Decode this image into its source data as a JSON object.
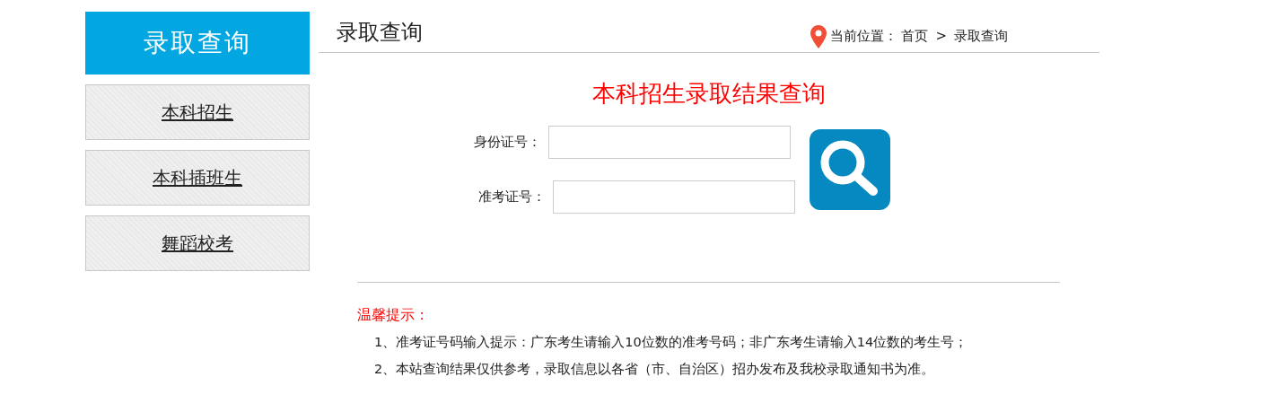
{
  "sidebar": {
    "title": "录取查询",
    "items": [
      {
        "label": "本科招生"
      },
      {
        "label": "本科插班生"
      },
      {
        "label": "舞蹈校考"
      }
    ]
  },
  "header": {
    "title": "录取查询",
    "breadcrumb": {
      "label": "当前位置：",
      "links": [
        "首页"
      ],
      "separator": ">",
      "current": "录取查询"
    }
  },
  "form": {
    "title": "本科招生录取结果查询",
    "fields": [
      {
        "label": "身份证号："
      },
      {
        "label": "准考证号："
      }
    ]
  },
  "notice": {
    "title": "温馨提示：",
    "items": [
      "1、准考证号码输入提示：广东考生请输入10位数的准考号码；非广东考生请输入14位数的考生号；",
      "2、本站查询结果仅供参考，录取信息以各省（市、自治区）招办发布及我校录取通知书为准。"
    ]
  }
}
